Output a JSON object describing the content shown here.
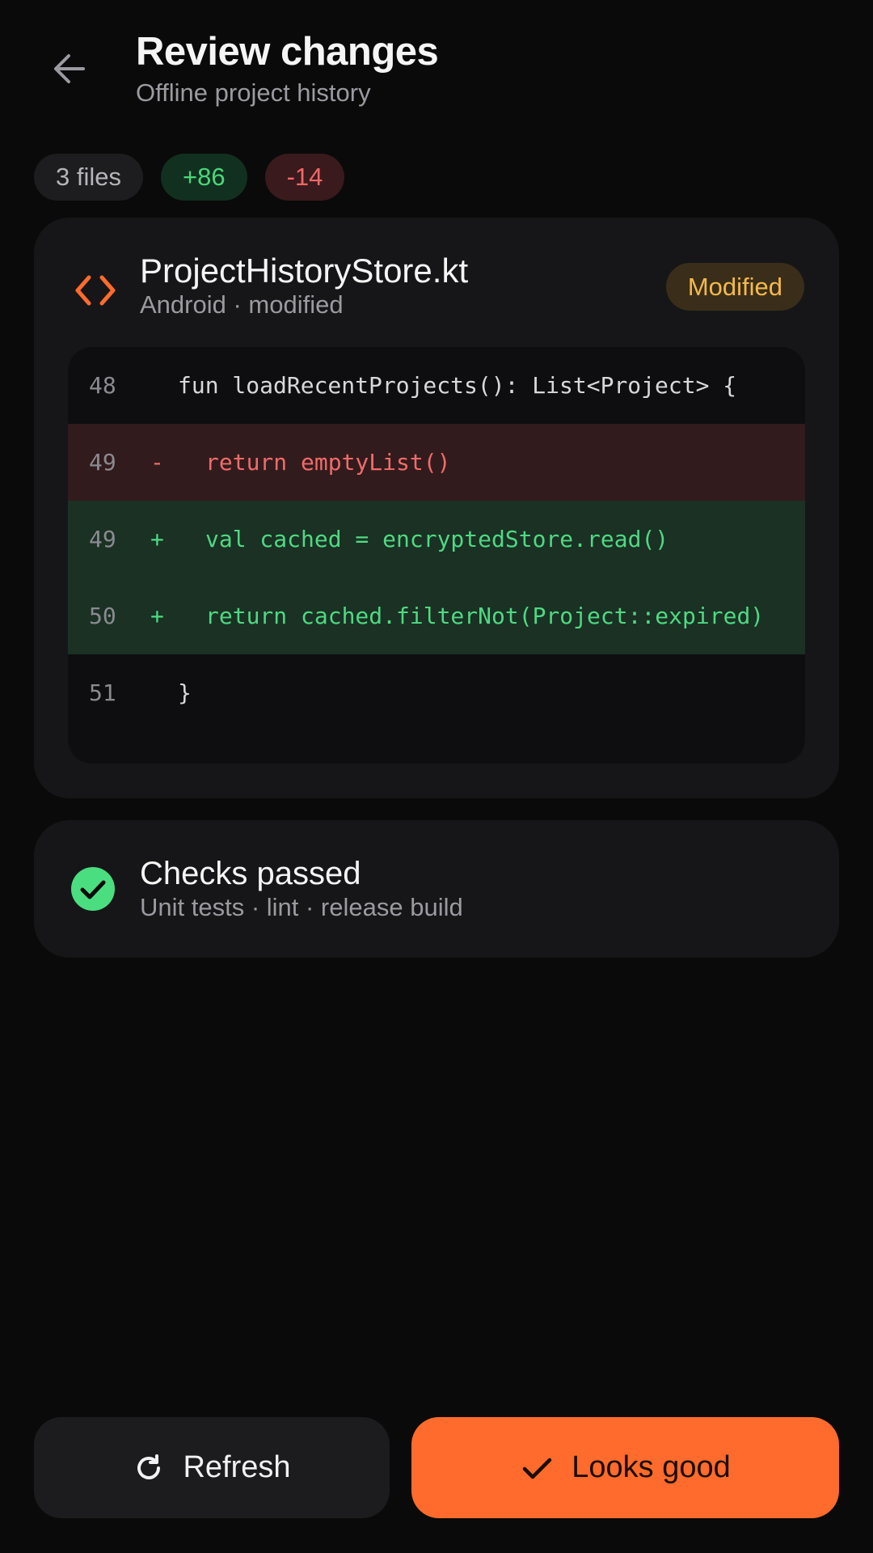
{
  "header": {
    "title": "Review changes",
    "subtitle": "Offline project history",
    "back_icon": "arrow-left-icon"
  },
  "stats": {
    "files": "3 files",
    "additions": "+86",
    "deletions": "-14"
  },
  "file": {
    "icon": "code-icon",
    "name": "ProjectHistoryStore.kt",
    "meta": "Android · modified",
    "status": "Modified",
    "diff": [
      {
        "line": "48",
        "sign": "",
        "code": "fun loadRecentProjects(): List<Project> {",
        "kind": "context"
      },
      {
        "line": "49",
        "sign": "-",
        "code": "return emptyList()",
        "kind": "deleted"
      },
      {
        "line": "49",
        "sign": "+",
        "code": "val cached = encryptedStore.read()",
        "kind": "added"
      },
      {
        "line": "50",
        "sign": "+",
        "code": "return cached.filterNot(Project::expired)",
        "kind": "added"
      },
      {
        "line": "51",
        "sign": "",
        "code": "}",
        "kind": "context"
      }
    ]
  },
  "checks": {
    "icon": "check-circle-icon",
    "title": "Checks passed",
    "subtitle": "Unit tests · lint · release build"
  },
  "actions": {
    "refresh_label": "Refresh",
    "refresh_icon": "refresh-icon",
    "approve_label": "Looks good",
    "approve_icon": "checkmark-icon"
  },
  "colors": {
    "background": "#0a0a0a",
    "card": "#161618",
    "accent": "#ff6b2c",
    "added": "#4fd982",
    "deleted": "#f06b6b",
    "badge_text": "#f5b94a"
  }
}
